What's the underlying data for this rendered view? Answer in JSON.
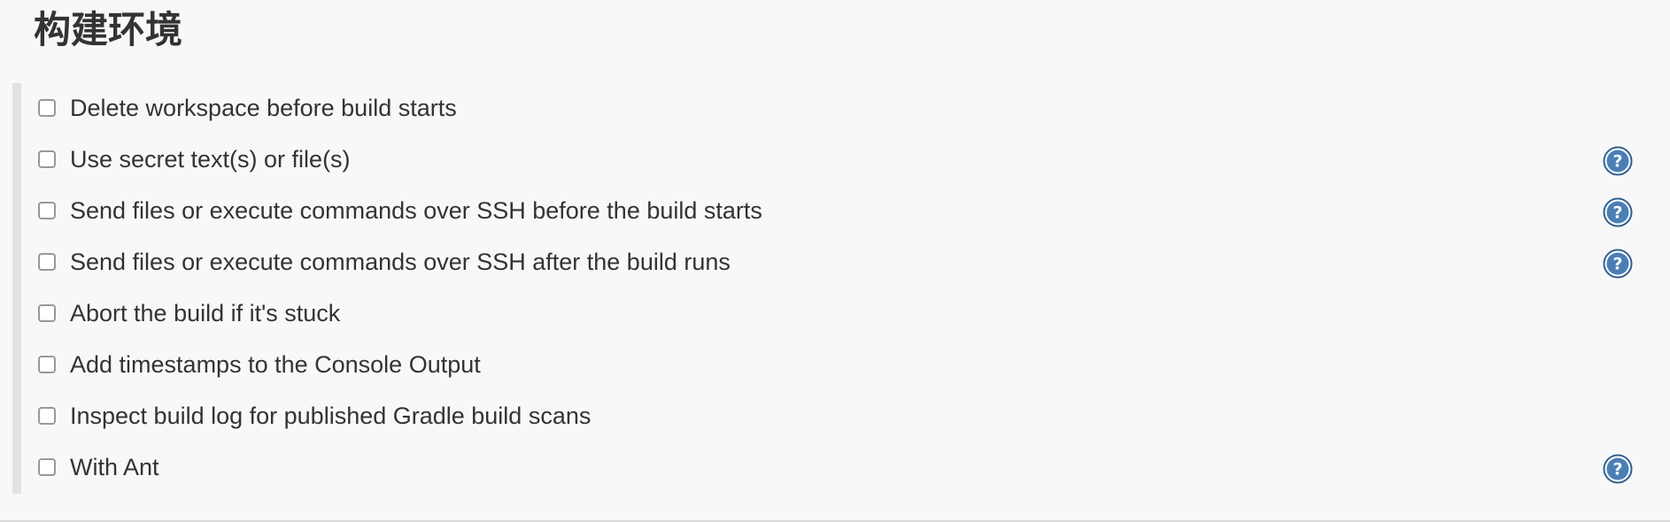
{
  "section": {
    "title": "构建环境"
  },
  "options": [
    {
      "label": "Delete workspace before build starts",
      "checked": false,
      "has_help": false
    },
    {
      "label": "Use secret text(s) or file(s)",
      "checked": false,
      "has_help": true
    },
    {
      "label": "Send files or execute commands over SSH before the build starts",
      "checked": false,
      "has_help": true
    },
    {
      "label": "Send files or execute commands over SSH after the build runs",
      "checked": false,
      "has_help": true
    },
    {
      "label": "Abort the build if it's stuck",
      "checked": false,
      "has_help": false
    },
    {
      "label": "Add timestamps to the Console Output",
      "checked": false,
      "has_help": false
    },
    {
      "label": "Inspect build log for published Gradle build scans",
      "checked": false,
      "has_help": false
    },
    {
      "label": "With Ant",
      "checked": false,
      "has_help": true
    }
  ],
  "icons": {
    "help": "help-icon"
  },
  "colors": {
    "help_icon_fill": "#4a7fb5",
    "help_icon_ring": "#2f5f91",
    "checkbox_border": "#999999",
    "section_rule": "#e2e2e2"
  }
}
